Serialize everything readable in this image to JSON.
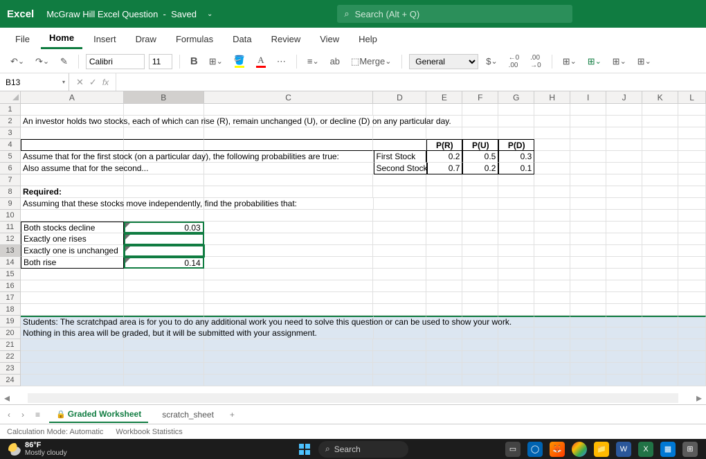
{
  "app": {
    "name": "Excel",
    "doc": "McGraw Hill Excel Question",
    "status": "Saved"
  },
  "search": {
    "placeholder": "Search (Alt + Q)"
  },
  "tabs": [
    "File",
    "Home",
    "Insert",
    "Draw",
    "Formulas",
    "Data",
    "Review",
    "View",
    "Help"
  ],
  "activeTab": "Home",
  "toolbar": {
    "font": "Calibri",
    "size": "11",
    "merge": "Merge",
    "format": "General"
  },
  "namebox": "B13",
  "formulaBar": "",
  "columns": [
    "A",
    "B",
    "C",
    "D",
    "E",
    "F",
    "G",
    "H",
    "I",
    "J",
    "K",
    "L"
  ],
  "selectedCol": "B",
  "selectedRow": 13,
  "cells": {
    "r2": {
      "A": "An investor holds two stocks, each of which can rise (R), remain unchanged (U), or decline (D) on any particular day."
    },
    "r4": {
      "E": "P(R)",
      "F": "P(U)",
      "G": "P(D)"
    },
    "r5": {
      "A": "Assume that for the first stock (on a particular day), the following probabilities are true:",
      "D": "First Stock",
      "E": "0.2",
      "F": "0.5",
      "G": "0.3"
    },
    "r6": {
      "A": "Also assume that for the second...",
      "D": "Second Stock",
      "E": "0.7",
      "F": "0.2",
      "G": "0.1"
    },
    "r8": {
      "A": "Required:"
    },
    "r9": {
      "A": "Assuming that these stocks move independently, find the probabilities that:"
    },
    "r11": {
      "A": "Both stocks decline",
      "B": "0.03"
    },
    "r12": {
      "A": "Exactly one rises",
      "B": ""
    },
    "r13": {
      "A": "Exactly one is unchanged",
      "B": ""
    },
    "r14": {
      "A": "Both rise",
      "B": "0.14"
    },
    "r19": {
      "A": "Students: The scratchpad area is for you to do any additional work you need to solve this question or can be used to show your work."
    },
    "r20": {
      "A": "Nothing in this area will be graded, but it will be submitted with your assignment."
    }
  },
  "sheets": {
    "active": "Graded Worksheet",
    "other": "scratch_sheet"
  },
  "statusbar": {
    "calc": "Calculation Mode: Automatic",
    "stats": "Workbook Statistics"
  },
  "taskbar": {
    "temp": "86°F",
    "cond": "Mostly cloudy",
    "search": "Search"
  }
}
